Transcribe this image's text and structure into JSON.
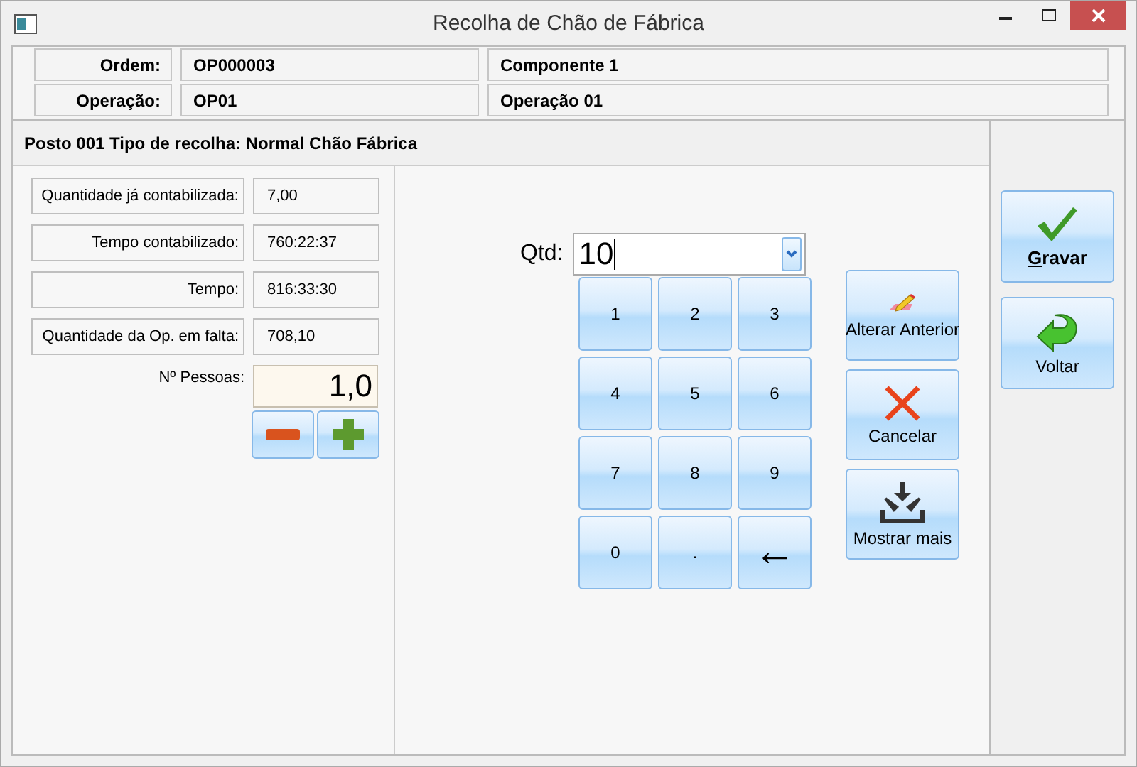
{
  "window": {
    "title": "Recolha de Chão de Fábrica"
  },
  "header": {
    "rows": [
      {
        "label": "Ordem:",
        "value": "OP000003",
        "description": "Componente 1"
      },
      {
        "label": "Operação:",
        "value": "OP01",
        "description": "Operação 01"
      }
    ]
  },
  "station_title": "Posto 001 Tipo de recolha: Normal Chão Fábrica",
  "info": [
    {
      "label": "Quantidade já contabilizada:",
      "value": "7,00"
    },
    {
      "label": "Tempo contabilizado:",
      "value": "760:22:37"
    },
    {
      "label": "Tempo:",
      "value": "816:33:30"
    },
    {
      "label": "Quantidade da Op. em falta:",
      "value": "708,10"
    }
  ],
  "people": {
    "label": "Nº Pessoas:",
    "value": "1,0"
  },
  "quantity": {
    "label": "Qtd:",
    "value": "10"
  },
  "keypad": [
    {
      "kind": "key",
      "label": "1"
    },
    {
      "kind": "key",
      "label": "2"
    },
    {
      "kind": "key",
      "label": "3"
    },
    {
      "kind": "key",
      "label": "4"
    },
    {
      "kind": "key",
      "label": "5"
    },
    {
      "kind": "key",
      "label": "6"
    },
    {
      "kind": "key",
      "label": "7"
    },
    {
      "kind": "key",
      "label": "8"
    },
    {
      "kind": "key",
      "label": "9"
    },
    {
      "kind": "key",
      "label": "0"
    },
    {
      "kind": "key",
      "label": "."
    },
    {
      "kind": "backspace",
      "label": "←"
    }
  ],
  "actions": [
    {
      "kind": "edit",
      "label": "Alterar Anterior"
    },
    {
      "kind": "cancel",
      "label": "Cancelar"
    },
    {
      "kind": "more",
      "label": "Mostrar mais"
    }
  ],
  "main_buttons": [
    {
      "kind": "save",
      "label": "Gravar",
      "accelerator": true
    },
    {
      "kind": "back",
      "label": "Voltar",
      "accelerator": false
    }
  ]
}
